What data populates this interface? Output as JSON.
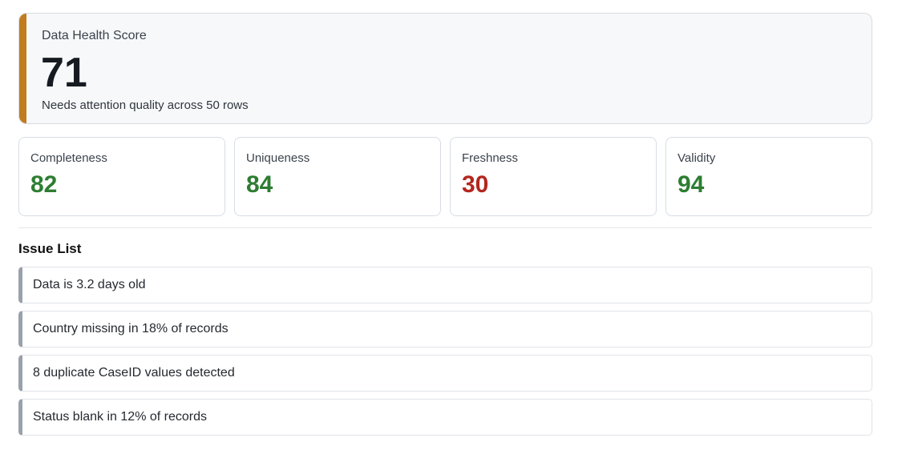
{
  "health": {
    "title": "Data Health Score",
    "score": "71",
    "summary": "Needs attention quality across 50 rows",
    "accent_color": "#c27c1e"
  },
  "metrics": [
    {
      "label": "Completeness",
      "value": "82",
      "color": "#2e7d32"
    },
    {
      "label": "Uniqueness",
      "value": "84",
      "color": "#2e7d32"
    },
    {
      "label": "Freshness",
      "value": "30",
      "color": "#b3261e"
    },
    {
      "label": "Validity",
      "value": "94",
      "color": "#2e7d32"
    }
  ],
  "issues": {
    "heading": "Issue List",
    "items": [
      "Data is 3.2 days old",
      "Country missing in 18% of records",
      "8 duplicate CaseID values detected",
      "Status blank in 12% of records"
    ]
  }
}
